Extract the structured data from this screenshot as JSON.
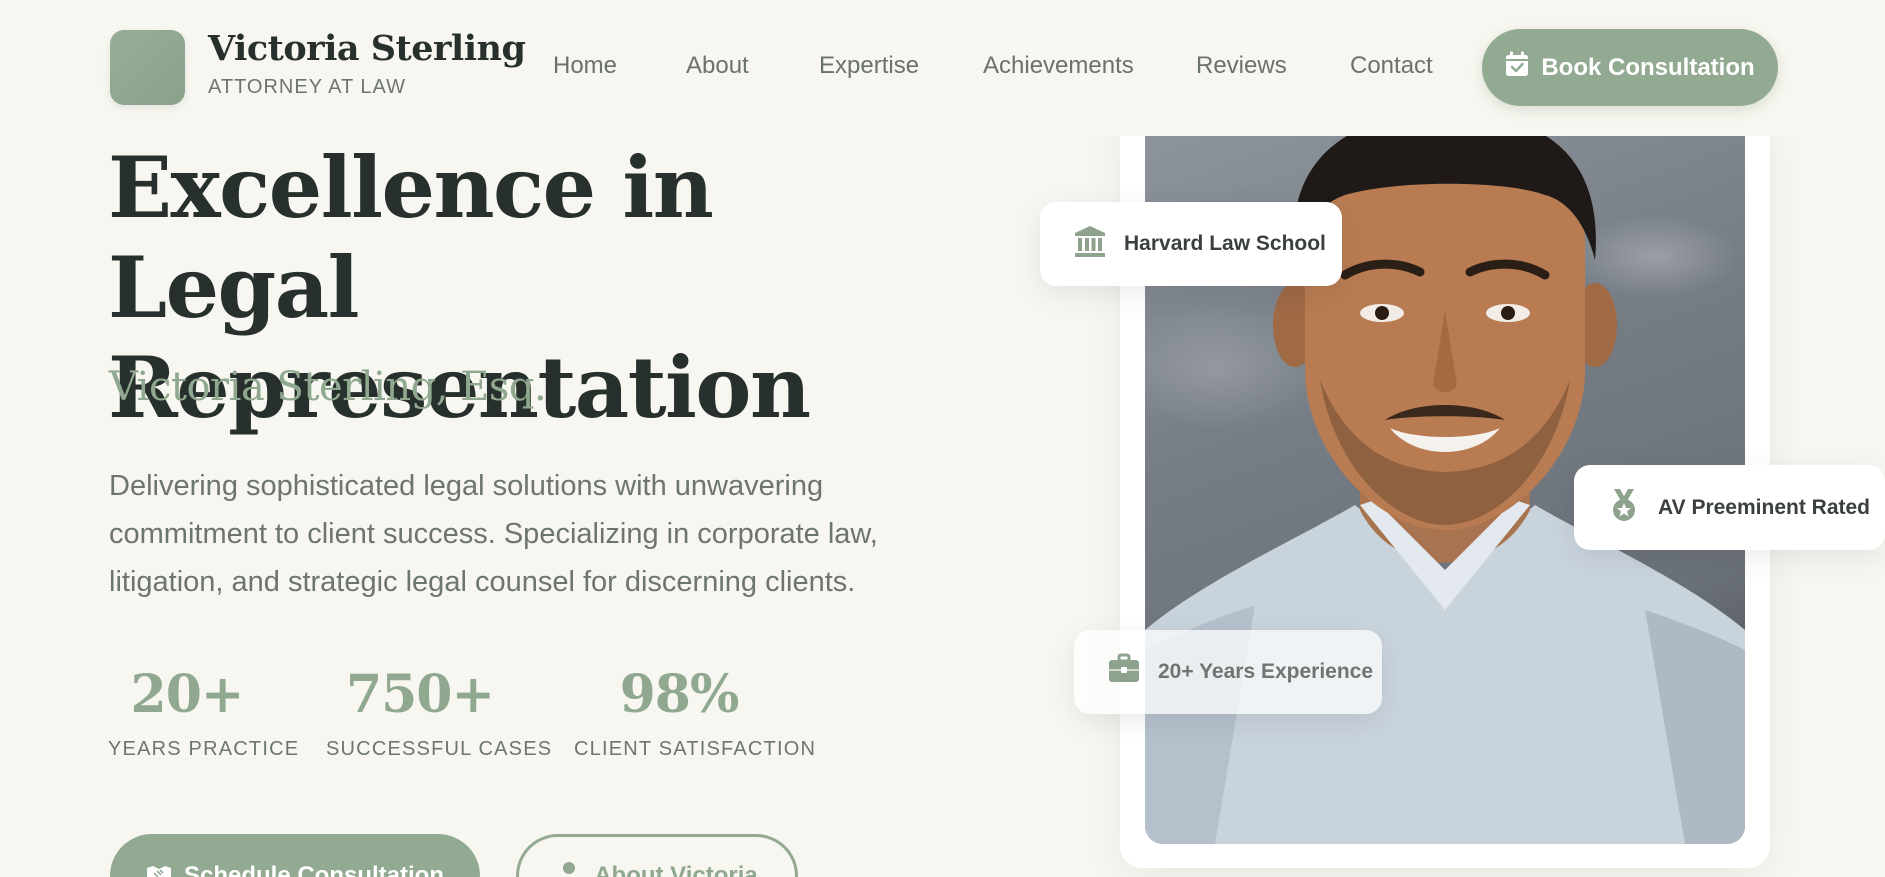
{
  "header": {
    "brand_name": "Victoria Sterling",
    "brand_subtitle": "ATTORNEY AT LAW",
    "nav": [
      {
        "label": "Home"
      },
      {
        "label": "About"
      },
      {
        "label": "Expertise"
      },
      {
        "label": "Achievements"
      },
      {
        "label": "Reviews"
      },
      {
        "label": "Contact"
      }
    ],
    "cta_label": "Book Consultation",
    "cta_icon": "calendar-check-icon"
  },
  "hero": {
    "title_line1": "Excellence in Legal",
    "title_line2": "Representation",
    "name": "Victoria Sterling, Esq.",
    "description": "Delivering sophisticated legal solutions with unwavering commitment to client success. Specializing in corporate law, litigation, and strategic legal counsel for discerning clients.",
    "stats": [
      {
        "value": "20+",
        "label": "YEARS PRACTICE"
      },
      {
        "value": "750+",
        "label": "SUCCESSFUL CASES"
      },
      {
        "value": "98%",
        "label": "CLIENT SATISFACTION"
      }
    ],
    "primary_button": {
      "label": "Schedule Consultation",
      "icon": "handshake-icon"
    },
    "secondary_button": {
      "label": "About Victoria",
      "icon": "user-icon"
    }
  },
  "badges": {
    "school": {
      "label": "Harvard Law School",
      "icon": "university-icon"
    },
    "rating": {
      "label": "AV Preeminent Rated",
      "icon": "award-medal-icon"
    },
    "experience": {
      "label": "20+ Years Experience",
      "icon": "briefcase-icon"
    }
  },
  "colors": {
    "accent": "#93aa92",
    "background": "#f7f6f0",
    "heading": "#27302c",
    "body_text": "#6d7570"
  }
}
